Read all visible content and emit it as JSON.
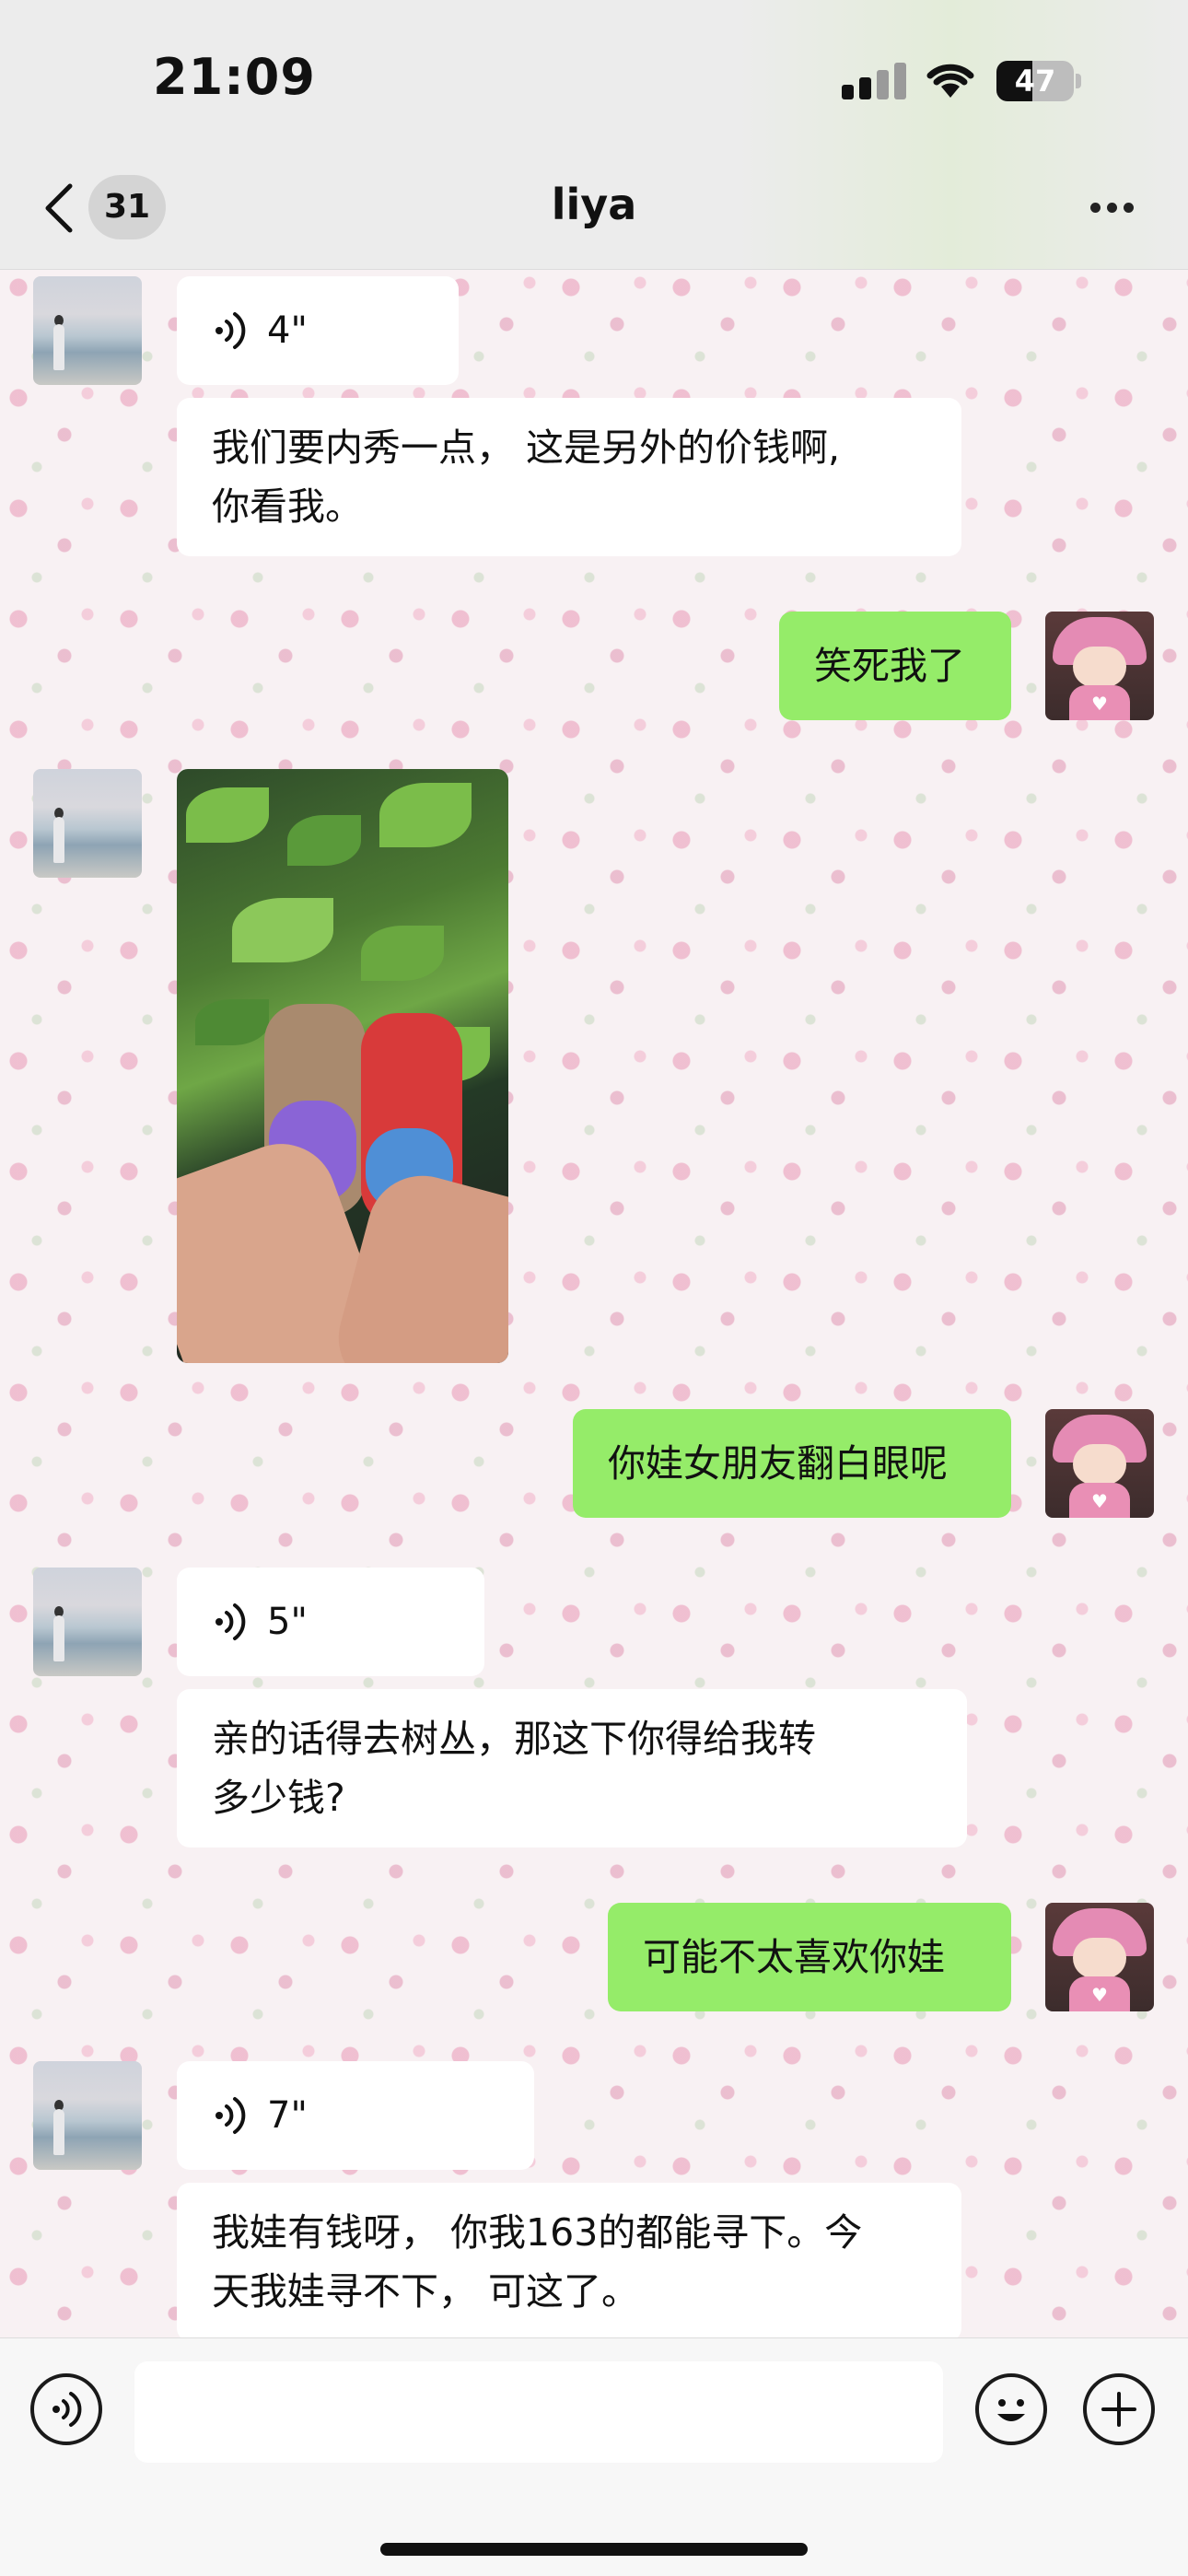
{
  "status_bar": {
    "time": "21:09",
    "battery": "47",
    "battery_level": 0.47
  },
  "header": {
    "back_badge": "31",
    "title": "liya"
  },
  "messages": [
    {
      "sender": "liya",
      "type": "voice",
      "duration": "4\""
    },
    {
      "sender": "liya",
      "type": "text",
      "lines": [
        "我们要内秀一点， 这是另外的价钱啊,",
        "你看我。"
      ]
    },
    {
      "sender": "me",
      "type": "text",
      "text": "笑死我了"
    },
    {
      "sender": "liya",
      "type": "image"
    },
    {
      "sender": "me",
      "type": "text",
      "text": "你娃女朋友翻白眼呢"
    },
    {
      "sender": "liya",
      "type": "voice",
      "duration": "5\""
    },
    {
      "sender": "liya",
      "type": "text",
      "lines": [
        "亲的话得去树丛，那这下你得给我转",
        "多少钱?"
      ]
    },
    {
      "sender": "me",
      "type": "text",
      "text": "可能不太喜欢你娃"
    },
    {
      "sender": "liya",
      "type": "voice",
      "duration": "7\""
    },
    {
      "sender": "liya",
      "type": "text",
      "lines": [
        "我娃有钱呀， 你我163的都能寻下。今",
        "天我娃寻不下， 可这了。"
      ]
    }
  ],
  "input_bar": {
    "placeholder": ""
  },
  "icons": [
    "back-chevron-icon",
    "more-icon",
    "voice-icon",
    "emoji-icon",
    "plus-icon"
  ]
}
